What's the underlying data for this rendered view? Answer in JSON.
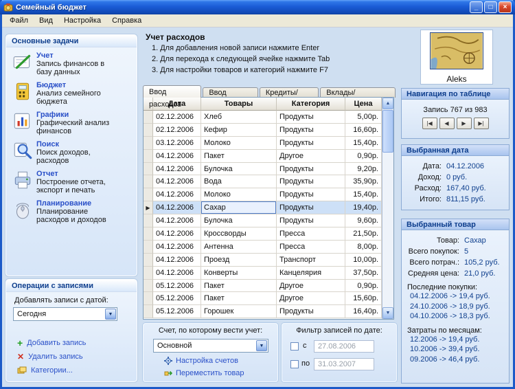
{
  "window": {
    "title": "Семейный бюджет",
    "menu": [
      "Файл",
      "Вид",
      "Настройка",
      "Справка"
    ]
  },
  "sidebar": {
    "tasks_header": "Основные задачи",
    "tasks": [
      {
        "label": "Учет",
        "desc": "Запись финансов в базу данных"
      },
      {
        "label": "Бюджет",
        "desc": "Анализ семейного бюджета"
      },
      {
        "label": "Графики",
        "desc": "Графический анализ финансов"
      },
      {
        "label": "Поиск",
        "desc": "Поиск доходов, расходов"
      },
      {
        "label": "Отчет",
        "desc": "Построение отчета, экспорт и печать"
      },
      {
        "label": "Планирование",
        "desc": "Планирование расходов и доходов"
      }
    ],
    "operations_header": "Операции с записями",
    "add_with_date_label": "Добавлять записи с датой:",
    "date_combo_value": "Сегодня",
    "add_record": "Добавить запись",
    "delete_record": "Удалить запись",
    "categories": "Категории..."
  },
  "main": {
    "header": "Учет расходов",
    "instructions": [
      "1. Для добавления новой записи нажмите Enter",
      "2. Для перехода к следующей ячейке нажмите Tab",
      "3. Для настройки товаров и категорий нажмите F7"
    ],
    "tabs": [
      "Ввод расходов",
      "Ввод доходов",
      "Кредиты/Долги",
      "Вклады/Инвестиции"
    ],
    "table": {
      "columns": [
        "Дата",
        "Товары",
        "Категория",
        "Цена"
      ],
      "selected_index": 7,
      "rows": [
        [
          "02.12.2006",
          "Хлеб",
          "Продукты",
          "5,00р."
        ],
        [
          "02.12.2006",
          "Кефир",
          "Продукты",
          "16,60р."
        ],
        [
          "03.12.2006",
          "Молоко",
          "Продукты",
          "15,40р."
        ],
        [
          "04.12.2006",
          "Пакет",
          "Другое",
          "0,90р."
        ],
        [
          "04.12.2006",
          "Булочка",
          "Продукты",
          "9,20р."
        ],
        [
          "04.12.2006",
          "Вода",
          "Продукты",
          "35,90р."
        ],
        [
          "04.12.2006",
          "Молоко",
          "Продукты",
          "15,40р."
        ],
        [
          "04.12.2006",
          "Сахар",
          "Продукты",
          "19,40р."
        ],
        [
          "04.12.2006",
          "Булочка",
          "Продукты",
          "9,60р."
        ],
        [
          "04.12.2006",
          "Кроссворды",
          "Пресса",
          "21,50р."
        ],
        [
          "04.12.2006",
          "Антенна",
          "Пресса",
          "8,00р."
        ],
        [
          "04.12.2006",
          "Проезд",
          "Транспорт",
          "10,00р."
        ],
        [
          "04.12.2006",
          "Конверты",
          "Канцелярия",
          "37,50р."
        ],
        [
          "05.12.2006",
          "Пакет",
          "Другое",
          "0,90р."
        ],
        [
          "05.12.2006",
          "Пакет",
          "Другое",
          "15,60р."
        ],
        [
          "05.12.2006",
          "Горошек",
          "Продукты",
          "16,40р."
        ]
      ]
    },
    "account_box": {
      "title": "Счет, по которому вести учет:",
      "combo_value": "Основной",
      "link_accounts": "Настройка счетов",
      "link_move": "Переместить товар"
    },
    "filter_box": {
      "title": "Фильтр записей по дате:",
      "from_label": "с",
      "from_value": "27.08.2006",
      "to_label": "по",
      "to_value": "31.03.2007"
    }
  },
  "right": {
    "user_name": "Aleks",
    "navigation": {
      "header": "Навигация по таблице",
      "record": "Запись 767 из 983"
    },
    "selected_date": {
      "header": "Выбранная дата",
      "rows": [
        {
          "label": "Дата:",
          "value": "04.12.2006"
        },
        {
          "label": "Доход:",
          "value": "0 руб."
        },
        {
          "label": "Расход:",
          "value": "167,40 руб."
        },
        {
          "label": "Итого:",
          "value": "811,15 руб."
        }
      ]
    },
    "selected_item": {
      "header": "Выбранный товар",
      "rows": [
        {
          "label": "Товар:",
          "value": "Сахар"
        },
        {
          "label": "Всего покупок:",
          "value": "5"
        },
        {
          "label": "Всего потрач.:",
          "value": "105,2 руб."
        },
        {
          "label": "Средняя цена:",
          "value": "21,0 руб."
        }
      ],
      "last_header": "Последние покупки:",
      "last": [
        "04.12.2006 -> 19,4 руб.",
        "24.10.2006 -> 18,9 руб.",
        "04.10.2006 -> 18,3 руб."
      ],
      "monthly_header": "Затраты по месяцам:",
      "monthly": [
        "12.2006 -> 19,4 руб.",
        "10.2006 -> 39,4 руб.",
        "09.2006 -> 46,4 руб."
      ]
    }
  },
  "colors": {
    "titlebar": "#1b5cd6",
    "link": "#2a50c8",
    "selection": "#cde0f7",
    "panel_header_text": "#0d3d8c"
  }
}
